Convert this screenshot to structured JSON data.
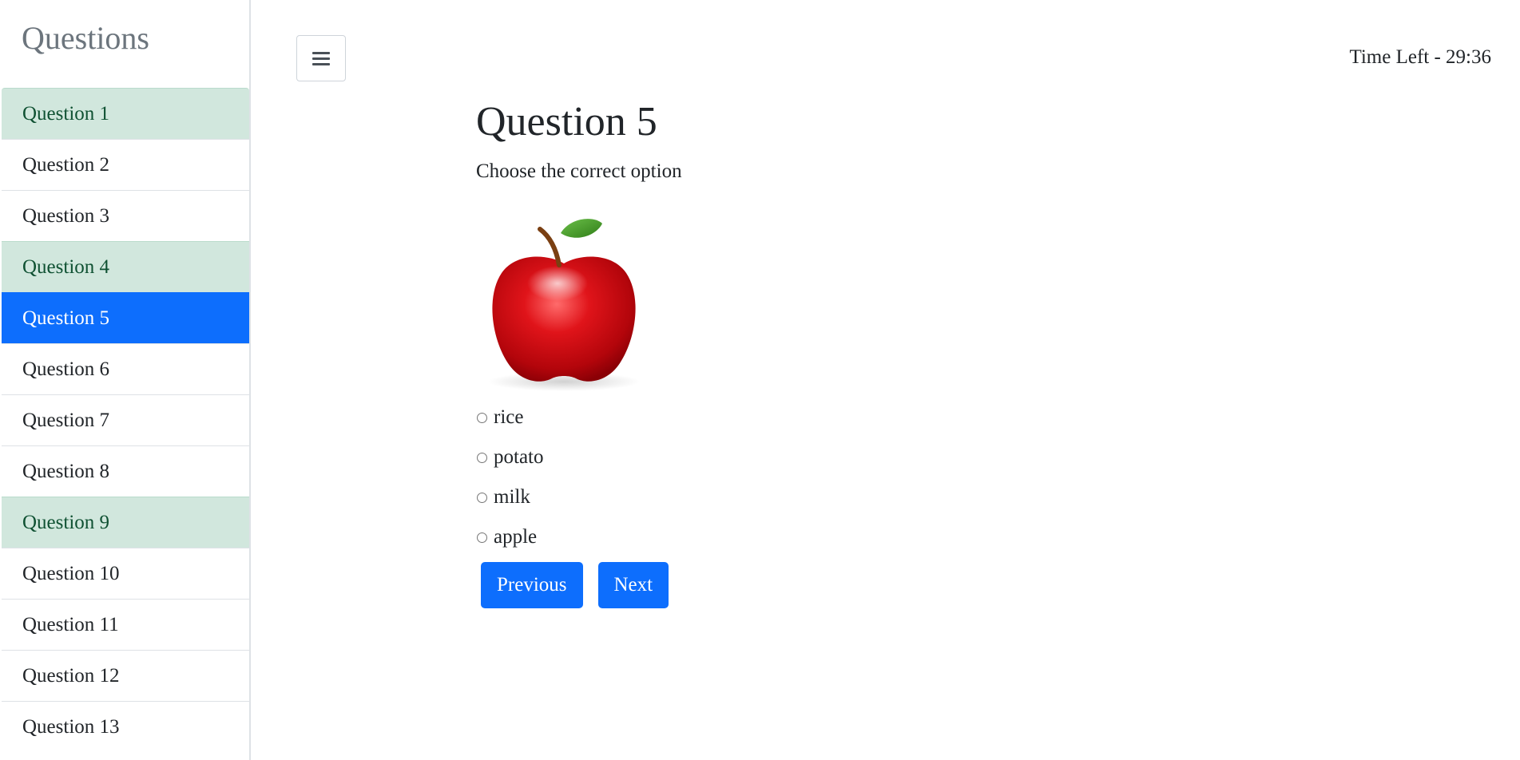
{
  "sidebar": {
    "heading": "Questions",
    "items": [
      {
        "label": "Question 1",
        "state": "answered"
      },
      {
        "label": "Question 2",
        "state": "default"
      },
      {
        "label": "Question 3",
        "state": "default"
      },
      {
        "label": "Question 4",
        "state": "answered"
      },
      {
        "label": "Question 5",
        "state": "active"
      },
      {
        "label": "Question 6",
        "state": "default"
      },
      {
        "label": "Question 7",
        "state": "default"
      },
      {
        "label": "Question 8",
        "state": "default"
      },
      {
        "label": "Question 9",
        "state": "answered"
      },
      {
        "label": "Question 10",
        "state": "default"
      },
      {
        "label": "Question 11",
        "state": "default"
      },
      {
        "label": "Question 12",
        "state": "default"
      },
      {
        "label": "Question 13",
        "state": "default"
      }
    ]
  },
  "header": {
    "menu_icon": "hamburger-icon",
    "timer": "Time Left - 29:36"
  },
  "question": {
    "title": "Question 5",
    "instruction": "Choose the correct option",
    "image_icon": "apple-image",
    "options": [
      "rice",
      "potato",
      "milk",
      "apple"
    ]
  },
  "buttons": {
    "previous": "Previous",
    "next": "Next"
  },
  "colors": {
    "primary": "#0d6efd",
    "answered_bg": "#d1e7dd",
    "answered_text": "#0f5132"
  }
}
